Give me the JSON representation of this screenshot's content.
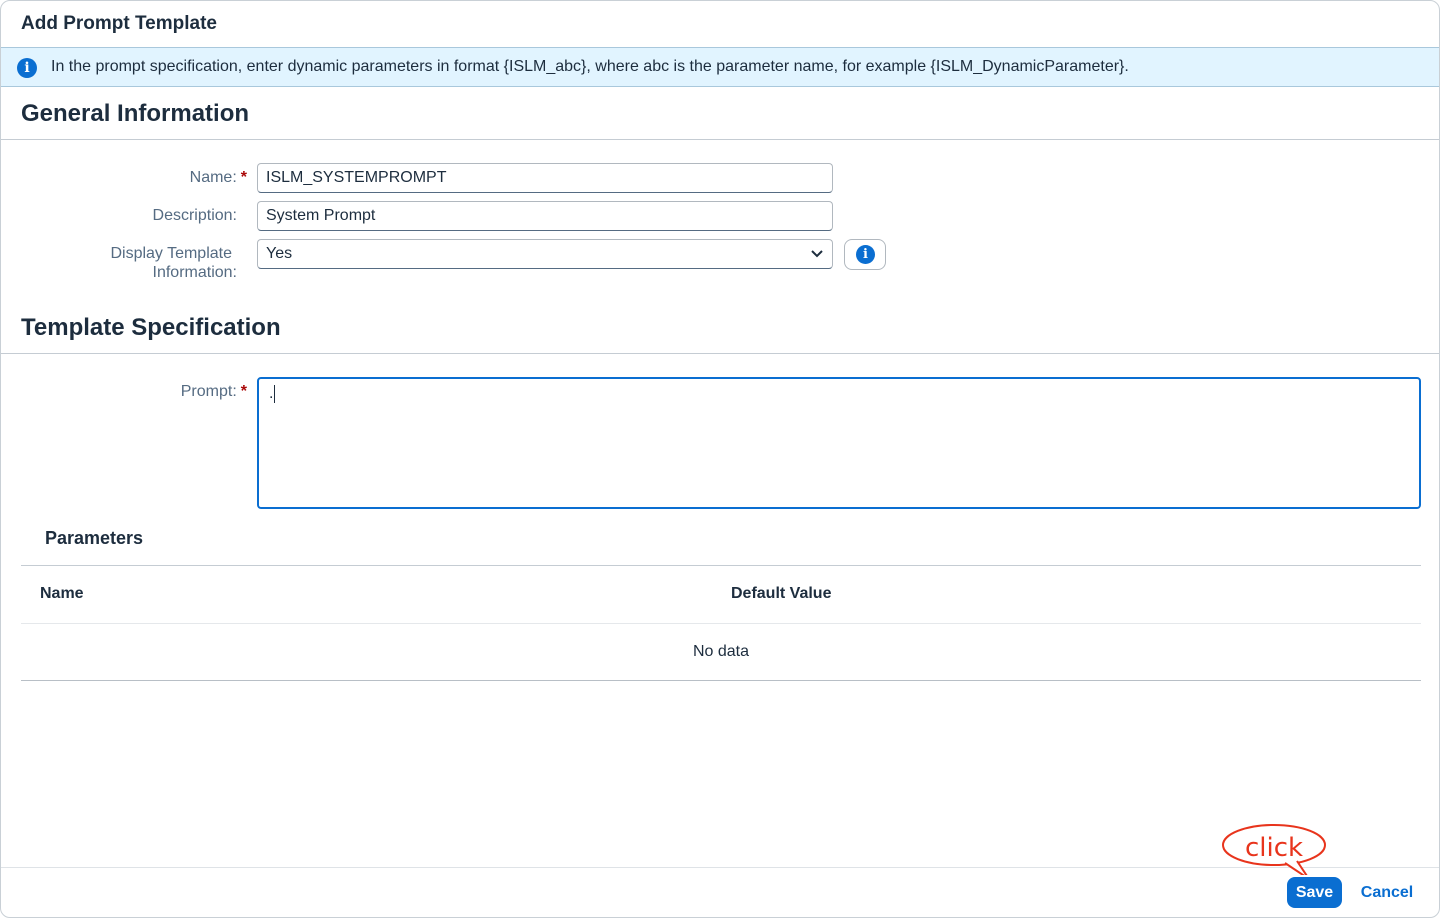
{
  "dialog": {
    "title": "Add Prompt Template"
  },
  "message_strip": {
    "icon": "info-icon",
    "text": "In the prompt specification, enter dynamic parameters in format {ISLM_abc}, where abc is the parameter name, for example {ISLM_DynamicParameter}."
  },
  "general": {
    "heading": "General Information",
    "name_label": "Name:",
    "name_value": "ISLM_SYSTEMPROMPT",
    "description_label": "Description:",
    "description_value": "System Prompt",
    "display_label_line1": "Display Template",
    "display_label_line2": "Information:",
    "display_value": "Yes",
    "required_marker": "*"
  },
  "template": {
    "heading": "Template Specification",
    "prompt_label": "Prompt:",
    "prompt_value": "."
  },
  "parameters": {
    "heading": "Parameters",
    "columns": [
      "Name",
      "Default Value"
    ],
    "empty_text": "No data"
  },
  "footer": {
    "save_label": "Save",
    "cancel_label": "Cancel"
  },
  "annotation": {
    "text": "click",
    "color": "#e8341c"
  },
  "colors": {
    "accent": "#0a6ed1",
    "info_strip_bg": "#e1f4ff",
    "required": "#aa0808"
  }
}
